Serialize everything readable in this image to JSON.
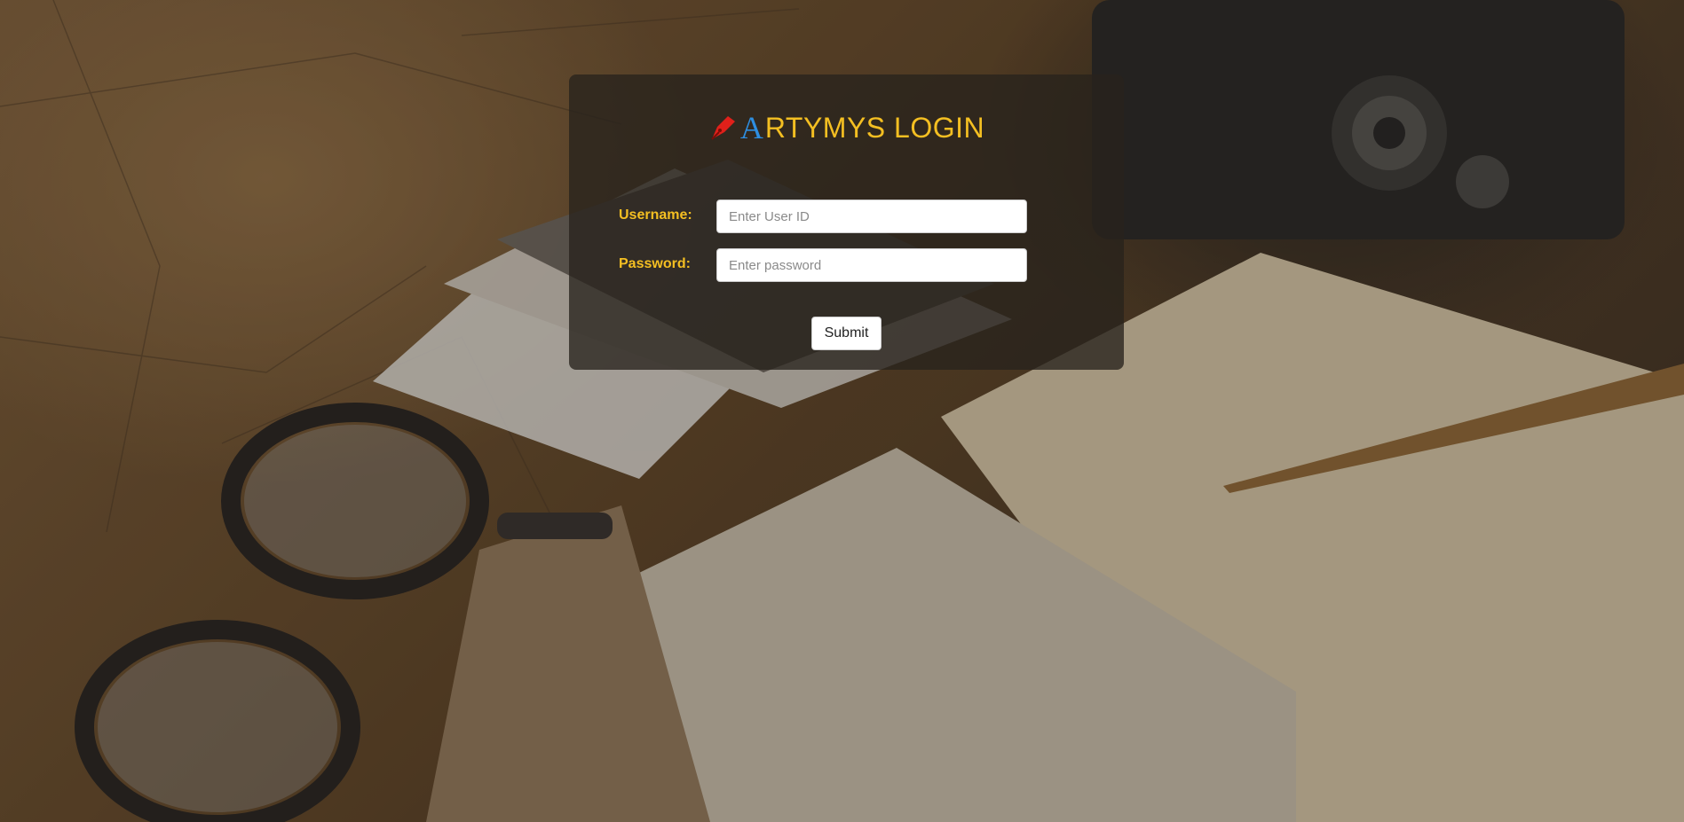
{
  "login": {
    "title_first_letter": "A",
    "title_rest": "RTYMYS LOGIN",
    "username": {
      "label": "Username:",
      "value": "",
      "placeholder": "Enter User ID"
    },
    "password": {
      "label": "Password:",
      "value": "",
      "placeholder": "Enter password"
    },
    "submit_label": "Submit"
  },
  "icons": {
    "logo": "pen-nib-icon"
  },
  "colors": {
    "title_first_letter": "#2e8ee0",
    "title_text": "#f4bf22",
    "labels": "#f4bf22",
    "logo": "#e0201a",
    "panel": "rgba(40,34,28,0.78)"
  }
}
